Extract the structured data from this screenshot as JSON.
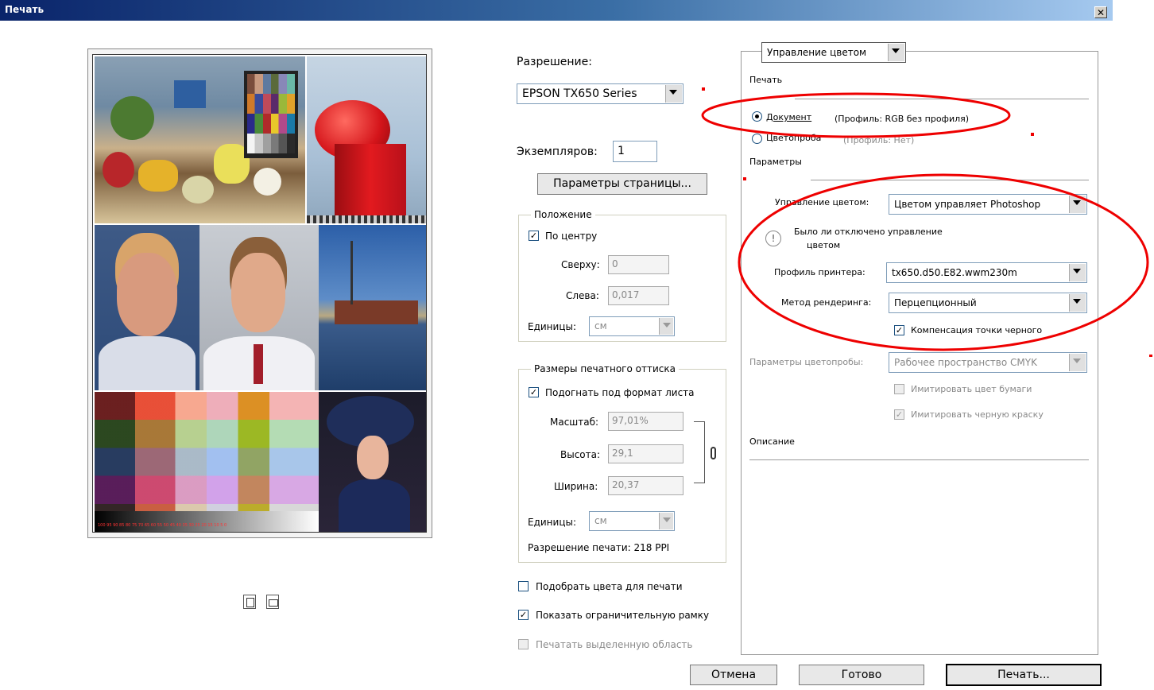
{
  "window": {
    "title": "Печать",
    "close_glyph": "✕"
  },
  "preview": {
    "grayscale_labels": "100 95 90 85 80 75 70 65 60 55 50 45 40 35 30 25 20 15 10 5 0"
  },
  "printer": {
    "label": "Разрешение:",
    "selected": "EPSON TX650 Series",
    "copies_label": "Экземпляров:",
    "copies_value": "1",
    "page_setup_button": "Параметры страницы..."
  },
  "position": {
    "legend": "Положение",
    "center_label": "По центру",
    "center_checked": true,
    "top_label": "Сверху:",
    "top_value": "0",
    "left_label": "Слева:",
    "left_value": "0,017",
    "units_label": "Единицы:",
    "units_value": "см"
  },
  "scaled": {
    "legend": "Размеры печатного оттиска",
    "fit_label": "Подогнать под формат листа",
    "fit_checked": true,
    "scale_label": "Масштаб:",
    "scale_value": "97,01%",
    "height_label": "Высота:",
    "height_value": "29,1",
    "width_label": "Ширина:",
    "width_value": "20,37",
    "units_label": "Единицы:",
    "units_value": "см",
    "resolution_text": "Разрешение печати: 218 PPI"
  },
  "options": {
    "match_colors": "Подобрать цвета для печати",
    "match_colors_checked": false,
    "bounding_box": "Показать ограничительную рамку",
    "bounding_box_checked": true,
    "print_selected": "Печатать выделенную область",
    "print_selected_checked": false
  },
  "color": {
    "section_selected": "Управление цветом",
    "print_label": "Печать",
    "document_label": "Документ",
    "document_profile": "(Профиль: RGB без профиля)",
    "proof_label": "Цветопроба",
    "proof_profile": "(Профиль: Нет)",
    "params_label": "Параметры",
    "handling_label": "Управление цветом:",
    "handling_value": "Цветом управляет Photoshop",
    "warning_text_1": "Было ли отключено управление",
    "warning_text_2": "цветом",
    "warning_glyph": "!",
    "printer_profile_label": "Профиль принтера:",
    "printer_profile_value": "tx650.d50.E82.wwm230m",
    "rendering_label": "Метод рендеринга:",
    "rendering_value": "Перцепционный",
    "bpc_label": "Компенсация точки черного",
    "bpc_checked": true,
    "proof_setup_label": "Параметры цветопробы:",
    "proof_setup_value": "Рабочее пространство CMYK",
    "simulate_paper": "Имитировать цвет бумаги",
    "simulate_paper_checked": false,
    "simulate_ink": "Имитировать черную краску",
    "simulate_ink_checked": true,
    "description_label": "Описание"
  },
  "buttons": {
    "cancel": "Отмена",
    "done": "Готово",
    "print": "Печать..."
  },
  "colors": {
    "annotation": "#e00000",
    "titlebar": "#0a246a"
  }
}
